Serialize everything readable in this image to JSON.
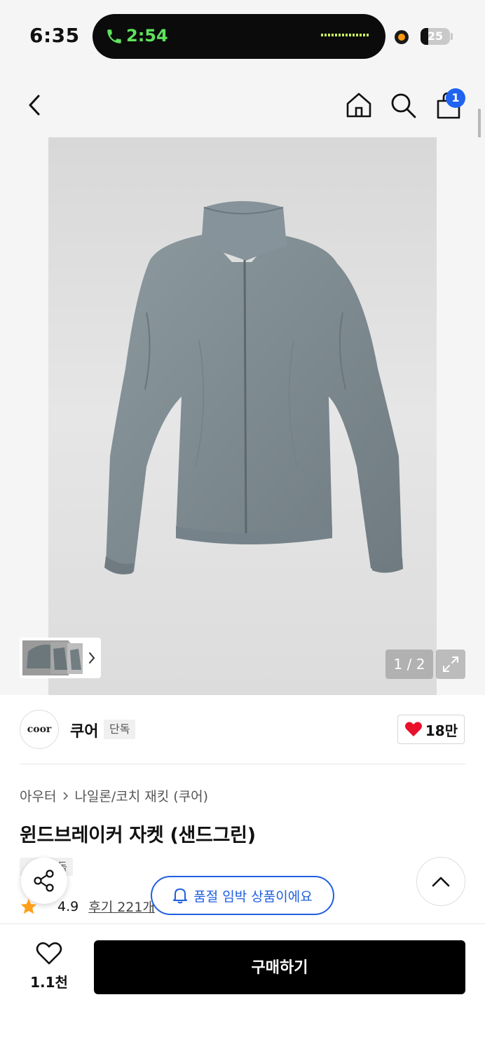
{
  "status_bar": {
    "time": "6:35",
    "call_time": "2:54",
    "battery": "25",
    "battery_level_percent": 25
  },
  "header": {
    "back_icon": "chevron-left-icon",
    "home_icon": "home-icon",
    "search_icon": "search-icon",
    "cart_icon": "shopping-bag-icon",
    "cart_count": "1"
  },
  "gallery": {
    "pager": "1 / 2",
    "thumbnails_icon": "chevron-right-icon",
    "expand_icon": "expand-icon"
  },
  "brand": {
    "logo_text": "coor",
    "name": "쿠어",
    "exclusive": "단독",
    "likes": "18만"
  },
  "product": {
    "breadcrumb": [
      "아우터",
      "나일론/코치 재킷 (쿠어)"
    ],
    "title": "윈드브레이커 자켓 (샌드그린)",
    "tag": "단독",
    "rating": "4.9",
    "reviews": "후기 221개",
    "soldout_notice": "품절 임박 상품이에요"
  },
  "bottom_bar": {
    "wish_count": "1.1천",
    "buy_label": "구매하기"
  },
  "colors": {
    "accent_blue": "#1f5fe0",
    "heart_red": "#e8102a",
    "star_orange": "#ff9f1a",
    "buy_button": "#000000"
  }
}
